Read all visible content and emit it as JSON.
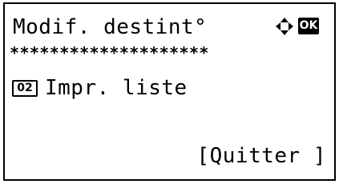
{
  "header": {
    "title": "Modif. destint°",
    "nav_icon": "four-way-arrow-icon",
    "ok_label": "OK"
  },
  "divider": {
    "text": "********************"
  },
  "menu": {
    "items": [
      {
        "number": "02",
        "label": "Impr. liste"
      }
    ]
  },
  "footer": {
    "quit_label": "[Quitter ]"
  }
}
